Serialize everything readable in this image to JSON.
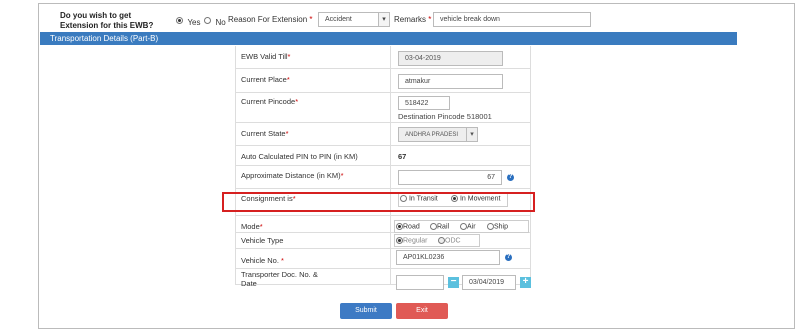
{
  "extension": {
    "question": "Do you wish to get Extension for this EWB?",
    "yes_label": "Yes",
    "no_label": "No",
    "reason_label": "Reason For Extension",
    "reason_value": "Accident",
    "remarks_label": "Remarks",
    "remarks_value": "vehicle break down"
  },
  "section_title": "Transportation Details (Part-B)",
  "fields": {
    "ewb_valid_till": {
      "label": "EWB Valid Till",
      "value": "03-04-2019"
    },
    "current_place": {
      "label": "Current Place",
      "value": "atmakur"
    },
    "current_pincode": {
      "label": "Current Pincode",
      "value": "518422",
      "note": "Destination Pincode 518001"
    },
    "current_state": {
      "label": "Current State",
      "value": "ANDHRA PRADESI"
    },
    "auto_distance": {
      "label": "Auto Calculated PIN to PIN (in KM)",
      "value": "67"
    },
    "approx_distance": {
      "label": "Approximate Distance (in KM)",
      "value": "67"
    },
    "consignment": {
      "label": "Consignment is",
      "opt1": "In Transit",
      "opt2": "In Movement"
    },
    "mode": {
      "label": "Mode",
      "opt1": "Road",
      "opt2": "Rail",
      "opt3": "Air",
      "opt4": "Ship"
    },
    "vehicle_type": {
      "label": "Vehicle Type",
      "opt1": "Regular",
      "opt2": "ODC"
    },
    "vehicle_no": {
      "label": "Vehicle No.",
      "value": "AP01KL0236"
    },
    "transporter_doc": {
      "label_line1": "Transporter Doc. No. &",
      "label_line2": "Date",
      "date_value": "03/04/2019"
    }
  },
  "buttons": {
    "submit": "Submit",
    "exit": "Exit"
  },
  "glyphs": {
    "required": "*",
    "help": "?",
    "minus": "−",
    "plus": "+",
    "caret": "▾"
  },
  "colors": {
    "header_bar": "#3a7bbf",
    "submit": "#3d7ac4",
    "exit": "#e05a55",
    "highlight": "#d62020"
  }
}
